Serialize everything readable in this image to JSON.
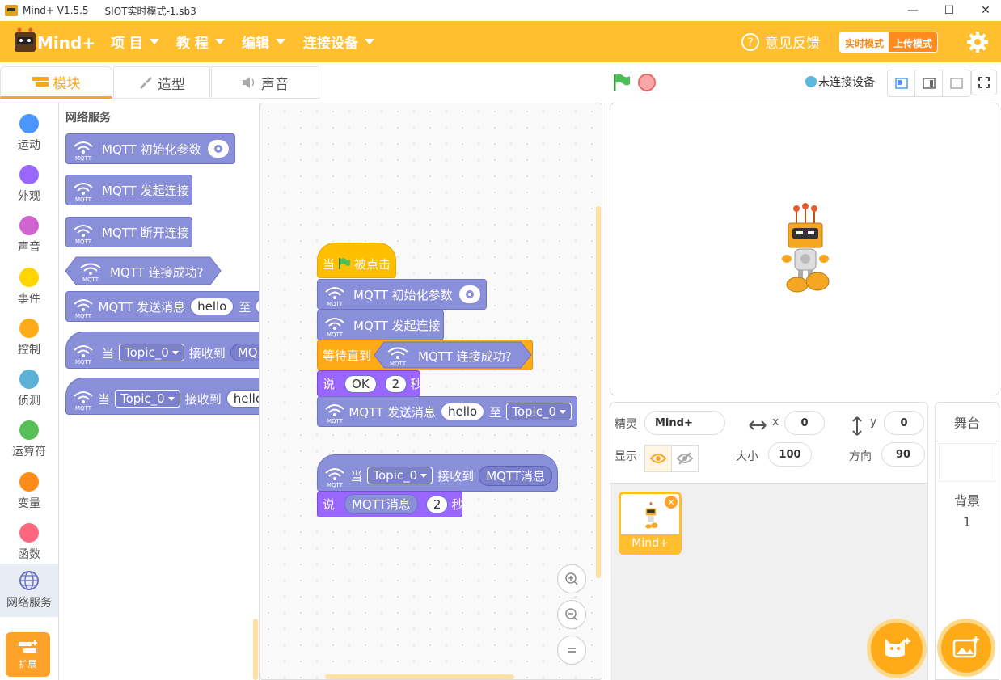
{
  "titlebar": {
    "app_name": "Mind+ V1.5.5",
    "file_name": "SIOT实时模式-1.sb3"
  },
  "menu": {
    "project": "项 目",
    "tutorial": "教 程",
    "edit": "编辑",
    "connect": "连接设备",
    "feedback": "意见反馈",
    "mode_realtime": "实时模式",
    "mode_upload": "上传模式"
  },
  "tabs": {
    "blocks": "模块",
    "costumes": "造型",
    "sounds": "声音"
  },
  "connection_status": "未连接设备",
  "categories": [
    {
      "label": "运动",
      "color": "#4c97ff"
    },
    {
      "label": "外观",
      "color": "#9966ff"
    },
    {
      "label": "声音",
      "color": "#cf63cf"
    },
    {
      "label": "事件",
      "color": "#ffd500"
    },
    {
      "label": "控制",
      "color": "#ffab19"
    },
    {
      "label": "侦测",
      "color": "#5cb1d6"
    },
    {
      "label": "运算符",
      "color": "#59c059"
    },
    {
      "label": "变量",
      "color": "#ff8c1a"
    },
    {
      "label": "函数",
      "color": "#ff6680"
    },
    {
      "label": "网络服务",
      "color": "#8a8fd9"
    }
  ],
  "extension_label": "扩展",
  "palette": {
    "title": "网络服务",
    "mqtt_init": "MQTT 初始化参数",
    "mqtt_connect": "MQTT 发起连接",
    "mqtt_disconnect": "MQTT 断开连接",
    "mqtt_connected": "MQTT 连接成功?",
    "mqtt_send": "MQTT 发送消息",
    "hello": "hello",
    "to": "至",
    "when": "当",
    "topic": "Topic_0",
    "received": "接收到",
    "mqt_cut": "MQ"
  },
  "script": {
    "when_flag": "当",
    "clicked": "被点击",
    "wait_until": "等待直到",
    "say": "说",
    "ok": "OK",
    "two": "2",
    "sec": "秒",
    "mqtt_msg": "MQTT消息"
  },
  "sprite": {
    "sprite_label": "精灵",
    "sprite_name": "Mind+",
    "x_label": "x",
    "x_value": "0",
    "y_label": "y",
    "y_value": "0",
    "show_label": "显示",
    "size_label": "大小",
    "size_value": "100",
    "dir_label": "方向",
    "dir_value": "90",
    "card_name": "Mind+"
  },
  "stage_panel": {
    "title": "舞台",
    "backdrop_label": "背景",
    "backdrop_count": "1"
  },
  "colors": {
    "brand": "#ffbf2f",
    "mqtt_block": "#8a8fd9",
    "event": "#ffbf00",
    "control": "#ffab19",
    "looks": "#9966ff"
  }
}
